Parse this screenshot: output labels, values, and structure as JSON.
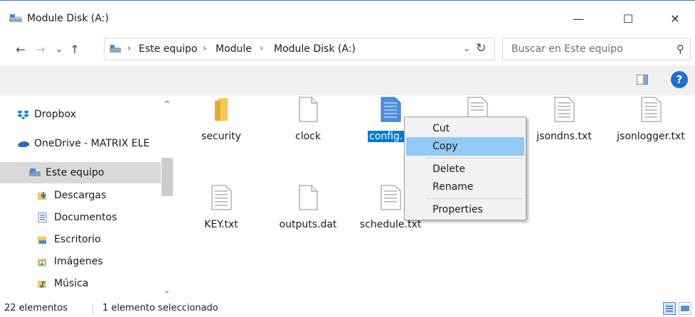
{
  "window": {
    "title": "Module Disk (A:)",
    "minimize_glyph": "—",
    "maximize_glyph": "☐",
    "close_glyph": "✕"
  },
  "address": {
    "back_glyph": "←",
    "forward_glyph": "→",
    "recent_glyph": "⌄",
    "up_glyph": "↑",
    "breadcrumbs": [
      "Este equipo",
      "Module",
      "Module Disk (A:)"
    ],
    "separator": "›",
    "dropdown_glyph": "⌄",
    "refresh_glyph": "↻"
  },
  "search": {
    "placeholder": "Buscar en Este equipo",
    "icon_glyph": "⚲"
  },
  "ribbon": {
    "help_label": "?"
  },
  "nav": {
    "items": [
      {
        "label": "Dropbox",
        "icon": "dropbox-icon"
      },
      {
        "label": "OneDrive - MATRIX ELE",
        "icon": "onedrive-icon"
      },
      {
        "label": "Este equipo",
        "icon": "this-pc-icon",
        "selected": true
      },
      {
        "label": "Descargas",
        "icon": "downloads-icon"
      },
      {
        "label": "Documentos",
        "icon": "documents-icon"
      },
      {
        "label": "Escritorio",
        "icon": "desktop-icon"
      },
      {
        "label": "Imágenes",
        "icon": "pictures-icon"
      },
      {
        "label": "Música",
        "icon": "music-icon"
      }
    ],
    "scroll_up_glyph": "^",
    "scroll_down_glyph": "⌄"
  },
  "files": [
    {
      "name": "security",
      "type": "folder"
    },
    {
      "name": "clock",
      "type": "file"
    },
    {
      "name": "config.",
      "type": "file-selected"
    },
    {
      "name": "",
      "type": "text"
    },
    {
      "name": "jsondns.txt",
      "type": "text"
    },
    {
      "name": "jsonlogger.txt",
      "type": "text"
    },
    {
      "name": "KEY.txt",
      "type": "text"
    },
    {
      "name": "outputs.dat",
      "type": "file"
    },
    {
      "name": "schedule.txt",
      "type": "text"
    }
  ],
  "context_menu": {
    "items": [
      "Cut",
      "Copy",
      "Delete",
      "Rename",
      "Properties"
    ],
    "highlighted": "Copy"
  },
  "status": {
    "count": "22 elementos",
    "selection": "1 elemento seleccionado"
  },
  "colors": {
    "accent": "#0078d7",
    "menu_highlight": "#91c9f7",
    "folder": "#f6c652"
  }
}
